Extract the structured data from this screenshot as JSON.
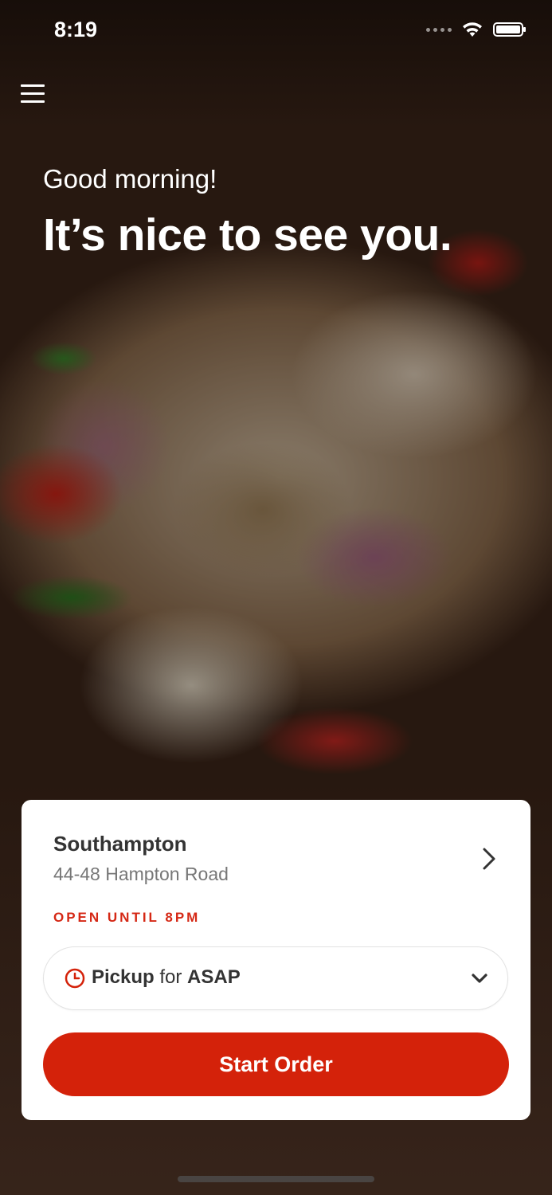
{
  "status_bar": {
    "time": "8:19",
    "icons": [
      "signal-icon",
      "wifi-icon",
      "battery-icon"
    ]
  },
  "header": {
    "menu_icon": "hamburger-menu-icon"
  },
  "hero": {
    "greeting": "Good morning!",
    "headline": "It’s nice to see you."
  },
  "store_card": {
    "name": "Southampton",
    "address": "44-48 Hampton Road",
    "open_status": "OPEN UNTIL 8PM",
    "pickup": {
      "mode": "Pickup",
      "connector": " for ",
      "time": "ASAP"
    },
    "start_button_label": "Start Order"
  },
  "colors": {
    "accent": "#d4220a",
    "open_status": "#d52815",
    "card_bg": "#ffffff"
  }
}
